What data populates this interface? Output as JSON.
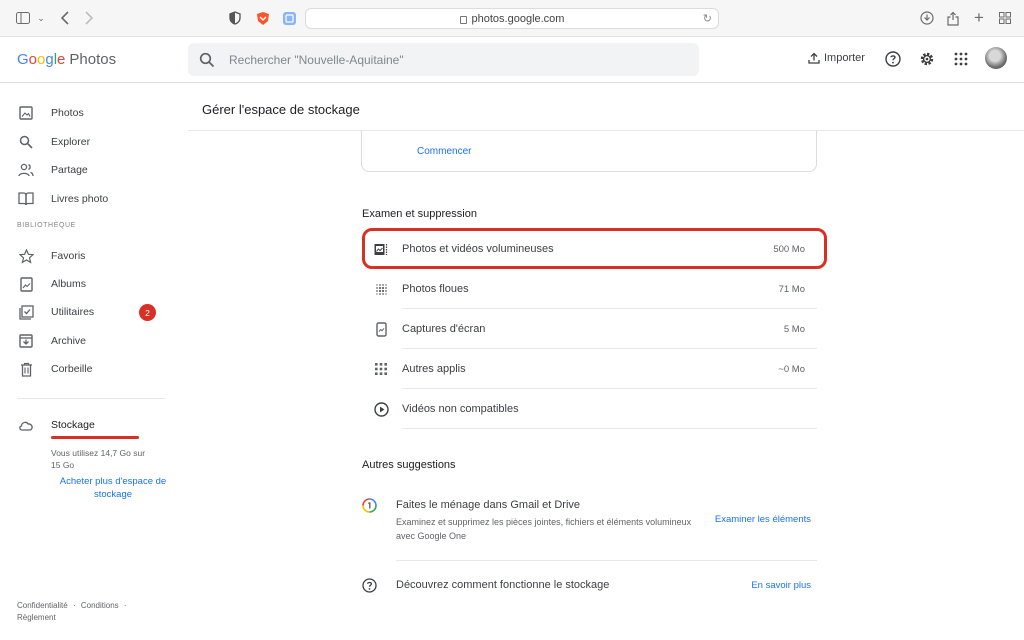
{
  "browser": {
    "url": "photos.google.com"
  },
  "header": {
    "logo_g": "G",
    "logo_o1": "o",
    "logo_o2": "o",
    "logo_g2": "g",
    "logo_l": "l",
    "logo_e": "e",
    "logo_photos": "Photos",
    "search_placeholder": "Rechercher \"Nouvelle-Aquitaine\"",
    "import_label": "Importer"
  },
  "sidebar": {
    "items": [
      {
        "label": "Photos",
        "icon": "image-icon"
      },
      {
        "label": "Explorer",
        "icon": "search-icon"
      },
      {
        "label": "Partage",
        "icon": "people-icon"
      },
      {
        "label": "Livres photo",
        "icon": "book-icon"
      }
    ],
    "section_label": "BIBLIOTHÈQUE",
    "library": [
      {
        "label": "Favoris",
        "icon": "star-icon"
      },
      {
        "label": "Albums",
        "icon": "album-icon"
      },
      {
        "label": "Utilitaires",
        "icon": "utilities-icon",
        "badge": "2"
      },
      {
        "label": "Archive",
        "icon": "archive-icon"
      },
      {
        "label": "Corbeille",
        "icon": "trash-icon"
      }
    ],
    "storage": {
      "label": "Stockage",
      "usage_text": "Vous utilisez 14,7 Go sur 15 Go",
      "buy_link": "Acheter plus d'espace de stockage",
      "used_fraction": 0.98
    },
    "footer": {
      "privacy": "Confidentialité",
      "sep": "·",
      "conditions": "Conditions",
      "rules": "Règlement"
    }
  },
  "main": {
    "title": "Gérer l'espace de stockage",
    "start_link": "Commencer",
    "review_heading": "Examen et suppression",
    "review_items": [
      {
        "label": "Photos et vidéos volumineuses",
        "size": "500 Mo"
      },
      {
        "label": "Photos floues",
        "size": "71 Mo"
      },
      {
        "label": "Captures d'écran",
        "size": "5 Mo"
      },
      {
        "label": "Autres applis",
        "size": "~0 Mo"
      },
      {
        "label": "Vidéos non compatibles",
        "size": ""
      }
    ],
    "other_heading": "Autres suggestions",
    "suggestions": [
      {
        "title": "Faites le ménage dans Gmail et Drive",
        "desc": "Examinez et supprimez les pièces jointes, fichiers et éléments volumineux avec Google One",
        "link": "Examiner les éléments"
      },
      {
        "title": "Découvrez comment fonctionne le stockage",
        "desc": "",
        "link": "En savoir plus"
      }
    ]
  },
  "colors": {
    "accent": "#1a73e8",
    "alert": "#d93025"
  }
}
